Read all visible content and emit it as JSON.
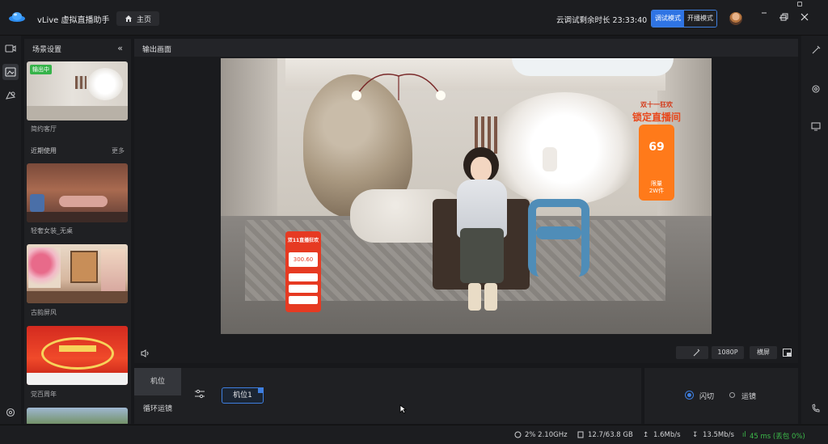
{
  "app": {
    "title": "vLive 虚拟直播助手",
    "home_label": "主页"
  },
  "trial": {
    "text": "云调试剩余时长 23:33:40"
  },
  "modes": {
    "debug_label": "调试模式",
    "live_label": "开播模式",
    "active": "debug"
  },
  "scene_panel": {
    "title": "场景设置",
    "current": {
      "name": "简约客厅",
      "badge": "输出中"
    },
    "recent_title": "近期使用",
    "more_label": "更多",
    "recent_items": [
      {
        "name": "轻奢女装_无桌"
      },
      {
        "name": "古韵屏风"
      },
      {
        "name": "党百周年"
      }
    ]
  },
  "output": {
    "title": "输出画面",
    "resolution": "1080P",
    "orientation": "横屏",
    "overlays": {
      "banner_top_line1": "双十一狂欢",
      "banner_top_line2": "锁定直播间",
      "banner_top_price": "69",
      "banner_top_tag": "限量",
      "banner_top_count": "2W件",
      "banner_left_title": "双11直播狂欢",
      "banner_left_price": "300.60"
    }
  },
  "bottom": {
    "tabs": [
      {
        "label": "机位"
      },
      {
        "label": "循环运镜"
      }
    ],
    "active_tab": 0,
    "camera_chip": "机位1"
  },
  "switch": {
    "options": [
      {
        "label": "闪切"
      },
      {
        "label": "运镜"
      }
    ],
    "selected": 0
  },
  "statusbar": {
    "cpu": "2% 2.10GHz",
    "memory": "12.7/63.8 GB",
    "upload": "1.6Mb/s",
    "download": "13.5Mb/s",
    "latency": "45 ms (丢包 0%)"
  },
  "colors": {
    "accent": "#2f74e4",
    "live_green": "#36b34a",
    "status_green": "#3dbb4a"
  },
  "icons": {
    "left_rail": [
      "video-camera-icon",
      "scene-icon",
      "effects-icon",
      "settings-icon"
    ],
    "right_rail": [
      "magic-wand-icon",
      "gear-icon",
      "monitor-icon",
      "phone-icon"
    ]
  }
}
